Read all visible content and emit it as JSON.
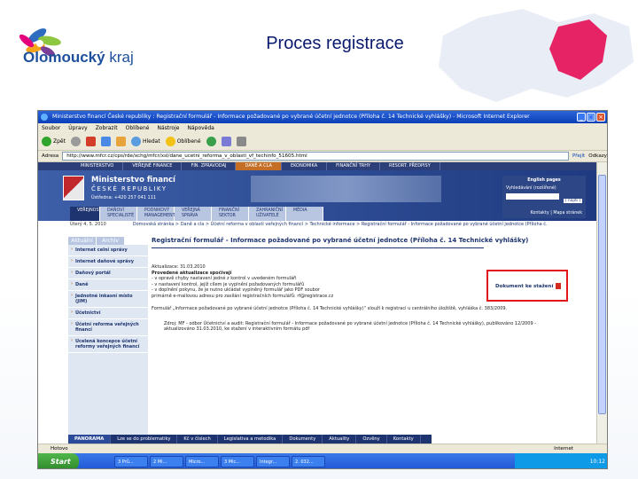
{
  "slide": {
    "title": "Proces registrace",
    "logo_name": "Olomoucký",
    "logo_suffix": "kraj"
  },
  "window": {
    "title": "Ministerstvo financí České republiky : Registrační formulář - Informace požadované po vybrané účetní jednotce (Příloha č. 14 Technické vyhlášky) - Microsoft Internet Explorer",
    "menu": [
      "Soubor",
      "Úpravy",
      "Zobrazit",
      "Oblíbené",
      "Nástroje",
      "Nápověda"
    ],
    "toolbar": {
      "back": "Zpět",
      "search": "Hledat",
      "favorites": "Oblíbené"
    },
    "address_label": "Adresa",
    "address": "http://www.mfcr.cz/cps/rde/xchg/mfcr/xsl/dane_ucetni_reforma_v_oblasti_vf_techinfo_51605.html",
    "go_label": "Přejít",
    "links_label": "Odkazy"
  },
  "site": {
    "top_nav": [
      "MINISTERSTVO",
      "VEŘEJNÉ FINANCE",
      "FIN. ZPRAVODAJ",
      "DANĚ A CLA",
      "EKONOMIKA",
      "FINANČNÍ TRHY",
      "RESORT. PŘEDPISY"
    ],
    "active_top_nav": 3,
    "ministry_title": "Ministerstvo financí",
    "ministry_subtitle": "ČESKÉ REPUBLIKY",
    "phone": "Ústředna: +420 257 041 111",
    "sub_nav": [
      "VEŘEJNOST",
      "DAŇOVÍ SPECIALISTÉ",
      "PODNIKOVÝ MANAGEMENT",
      "VEŘEJNÁ SPRÁVA",
      "FINANČNÍ SEKTOR",
      "ZAHRANIČNÍ UŽIVATELÉ",
      "MÉDIA"
    ],
    "right_box": {
      "english": "English pages",
      "search_label": "Vyhledávání (rozšířené)",
      "search_btn": "[ najdi ]",
      "links": "Kontakty | Mapa stránek"
    },
    "date": "Úterý 4. 5. 2010",
    "breadcrumb": "Domovská stránka > Daně a cla > Účetní reforma v oblasti veřejných financí > Technické informace > Registrační formulář - Informace požadované po vybrané účetní jednotce (Příloha č. 14 Technické vyhlášky)",
    "tabs": [
      "Aktuální",
      "Archiv"
    ],
    "left_menu": [
      "Internet celní správy",
      "Internet daňové správy",
      "Daňový portál",
      "Daně",
      "Jednotné inkasní místo (JIM)",
      "Účetnictví",
      "Účetní reforma veřejných financí",
      "Ucelená koncepce účetní reformy veřejných financí"
    ],
    "page_title": "Registrační formulář - Informace požadované po vybrané účetní jednotce (Příloha č. 14 Technické vyhlášky)",
    "notes": [
      {
        "text": "Aktualizace: 31.03.2010",
        "bold": false
      },
      {
        "text": "Provedené aktualizace spočívají",
        "bold": true
      },
      {
        "text": "- v opravě chyby nastavení jedné z kontrol v uvedeném formuláři",
        "bold": false
      },
      {
        "text": "- v nastavení kontrol, jejíž cílem je vyplnění požadovaných formulářů",
        "bold": false
      },
      {
        "text": "- v doplnění pokynu, že je nutno ukládat vyplněný formulář jako PDF soubor",
        "bold": false
      },
      {
        "text": "  primárně e-mailovou adresu pro zasílání registračních formulářů: rf@registrace.cz",
        "bold": false
      }
    ],
    "description": "Formulář „Informace požadované po vybrané účetní jednotce (Příloha č. 14 Technické vyhlášky)“ slouží k registraci u centrálního úložiště, vyhláška č. 383/2009.",
    "document_line": "Zdroj: MF - odbor Účetnictví a audit: Registrační formulář - Informace požadované po vybrané účetní jednotce (Příloha č. 14 Technické vyhlášky), publikováno 12/2009 - aktualizováno 31.03.2010, ke stažení v interaktivním formátu pdf",
    "doc_download": "Dokument ke stažení",
    "footer": [
      "PANORAMA",
      "Lze se do problematiky",
      "Kč v číslech",
      "Legislativa a metodika",
      "Dokumenty",
      "Aktuality",
      "Ozvěny",
      "Kontakty"
    ]
  },
  "status": {
    "left": "Hotovo",
    "zone": "Internet"
  },
  "taskbar": {
    "start": "Start",
    "tasks": [
      "3 Prů...",
      "2 Mi...",
      "Micro...",
      "3 Mic...",
      "Integr...",
      "2. 032..."
    ],
    "clock": "10:12"
  },
  "colors": {
    "title": "#0a1a6e",
    "highlight_border": "#e0161a",
    "site_navy": "#1e3470"
  }
}
